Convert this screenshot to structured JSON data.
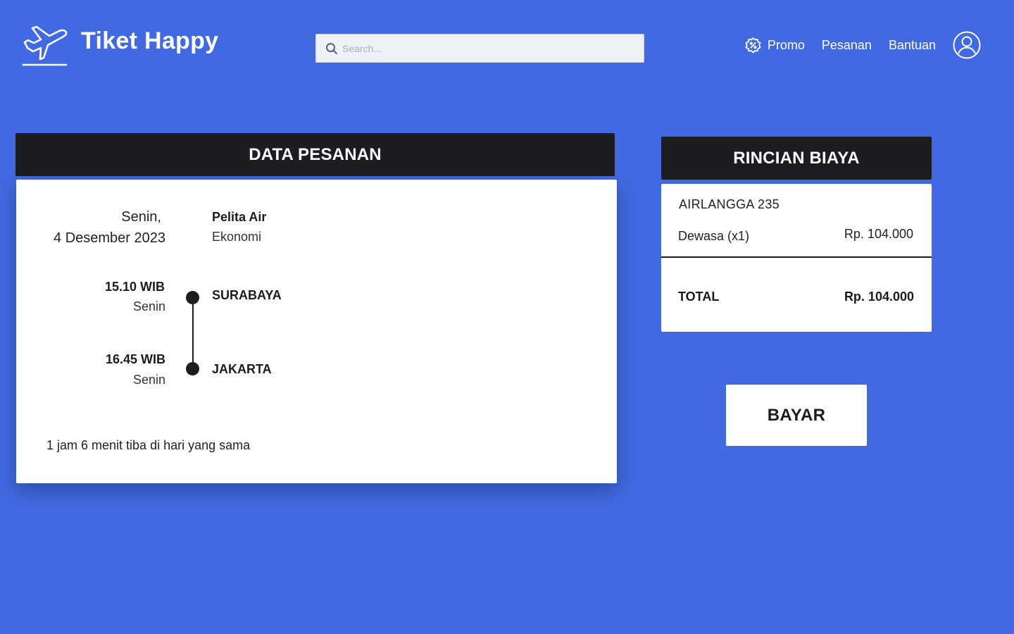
{
  "header": {
    "brand": "Tiket Happy",
    "search_placeholder": "Search...",
    "nav": {
      "promo": "Promo",
      "pesanan": "Pesanan",
      "bantuan": "Bantuan"
    },
    "icons": {
      "logo": "airplane-takeoff-icon",
      "search": "search-icon",
      "promo": "discount-badge-icon",
      "avatar": "user-circle-icon"
    }
  },
  "order": {
    "heading": "DATA PESANAN",
    "day_label": "Senin,",
    "date_label": "4 Desember 2023",
    "airline": "Pelita Air",
    "cabin_class": "Ekonomi",
    "departure": {
      "time": "15.10 WIB",
      "day": "Senin",
      "city": "SURABAYA"
    },
    "arrival": {
      "time": "16.45 WIB",
      "day": "Senin",
      "city": "JAKARTA"
    },
    "duration_note": "1 jam 6 menit tiba di hari yang sama"
  },
  "cost": {
    "heading": "RINCIAN BIAYA",
    "flight_number": "AIRLANGGA 235",
    "passenger_label": "Dewasa (x1)",
    "passenger_price": "Rp. 104.000",
    "total_label": "TOTAL",
    "total_price": "Rp. 104.000"
  },
  "actions": {
    "pay_label": "BAYAR"
  },
  "colors": {
    "background": "#4169e1",
    "dark": "#1b1d21",
    "card": "#ffffff"
  }
}
